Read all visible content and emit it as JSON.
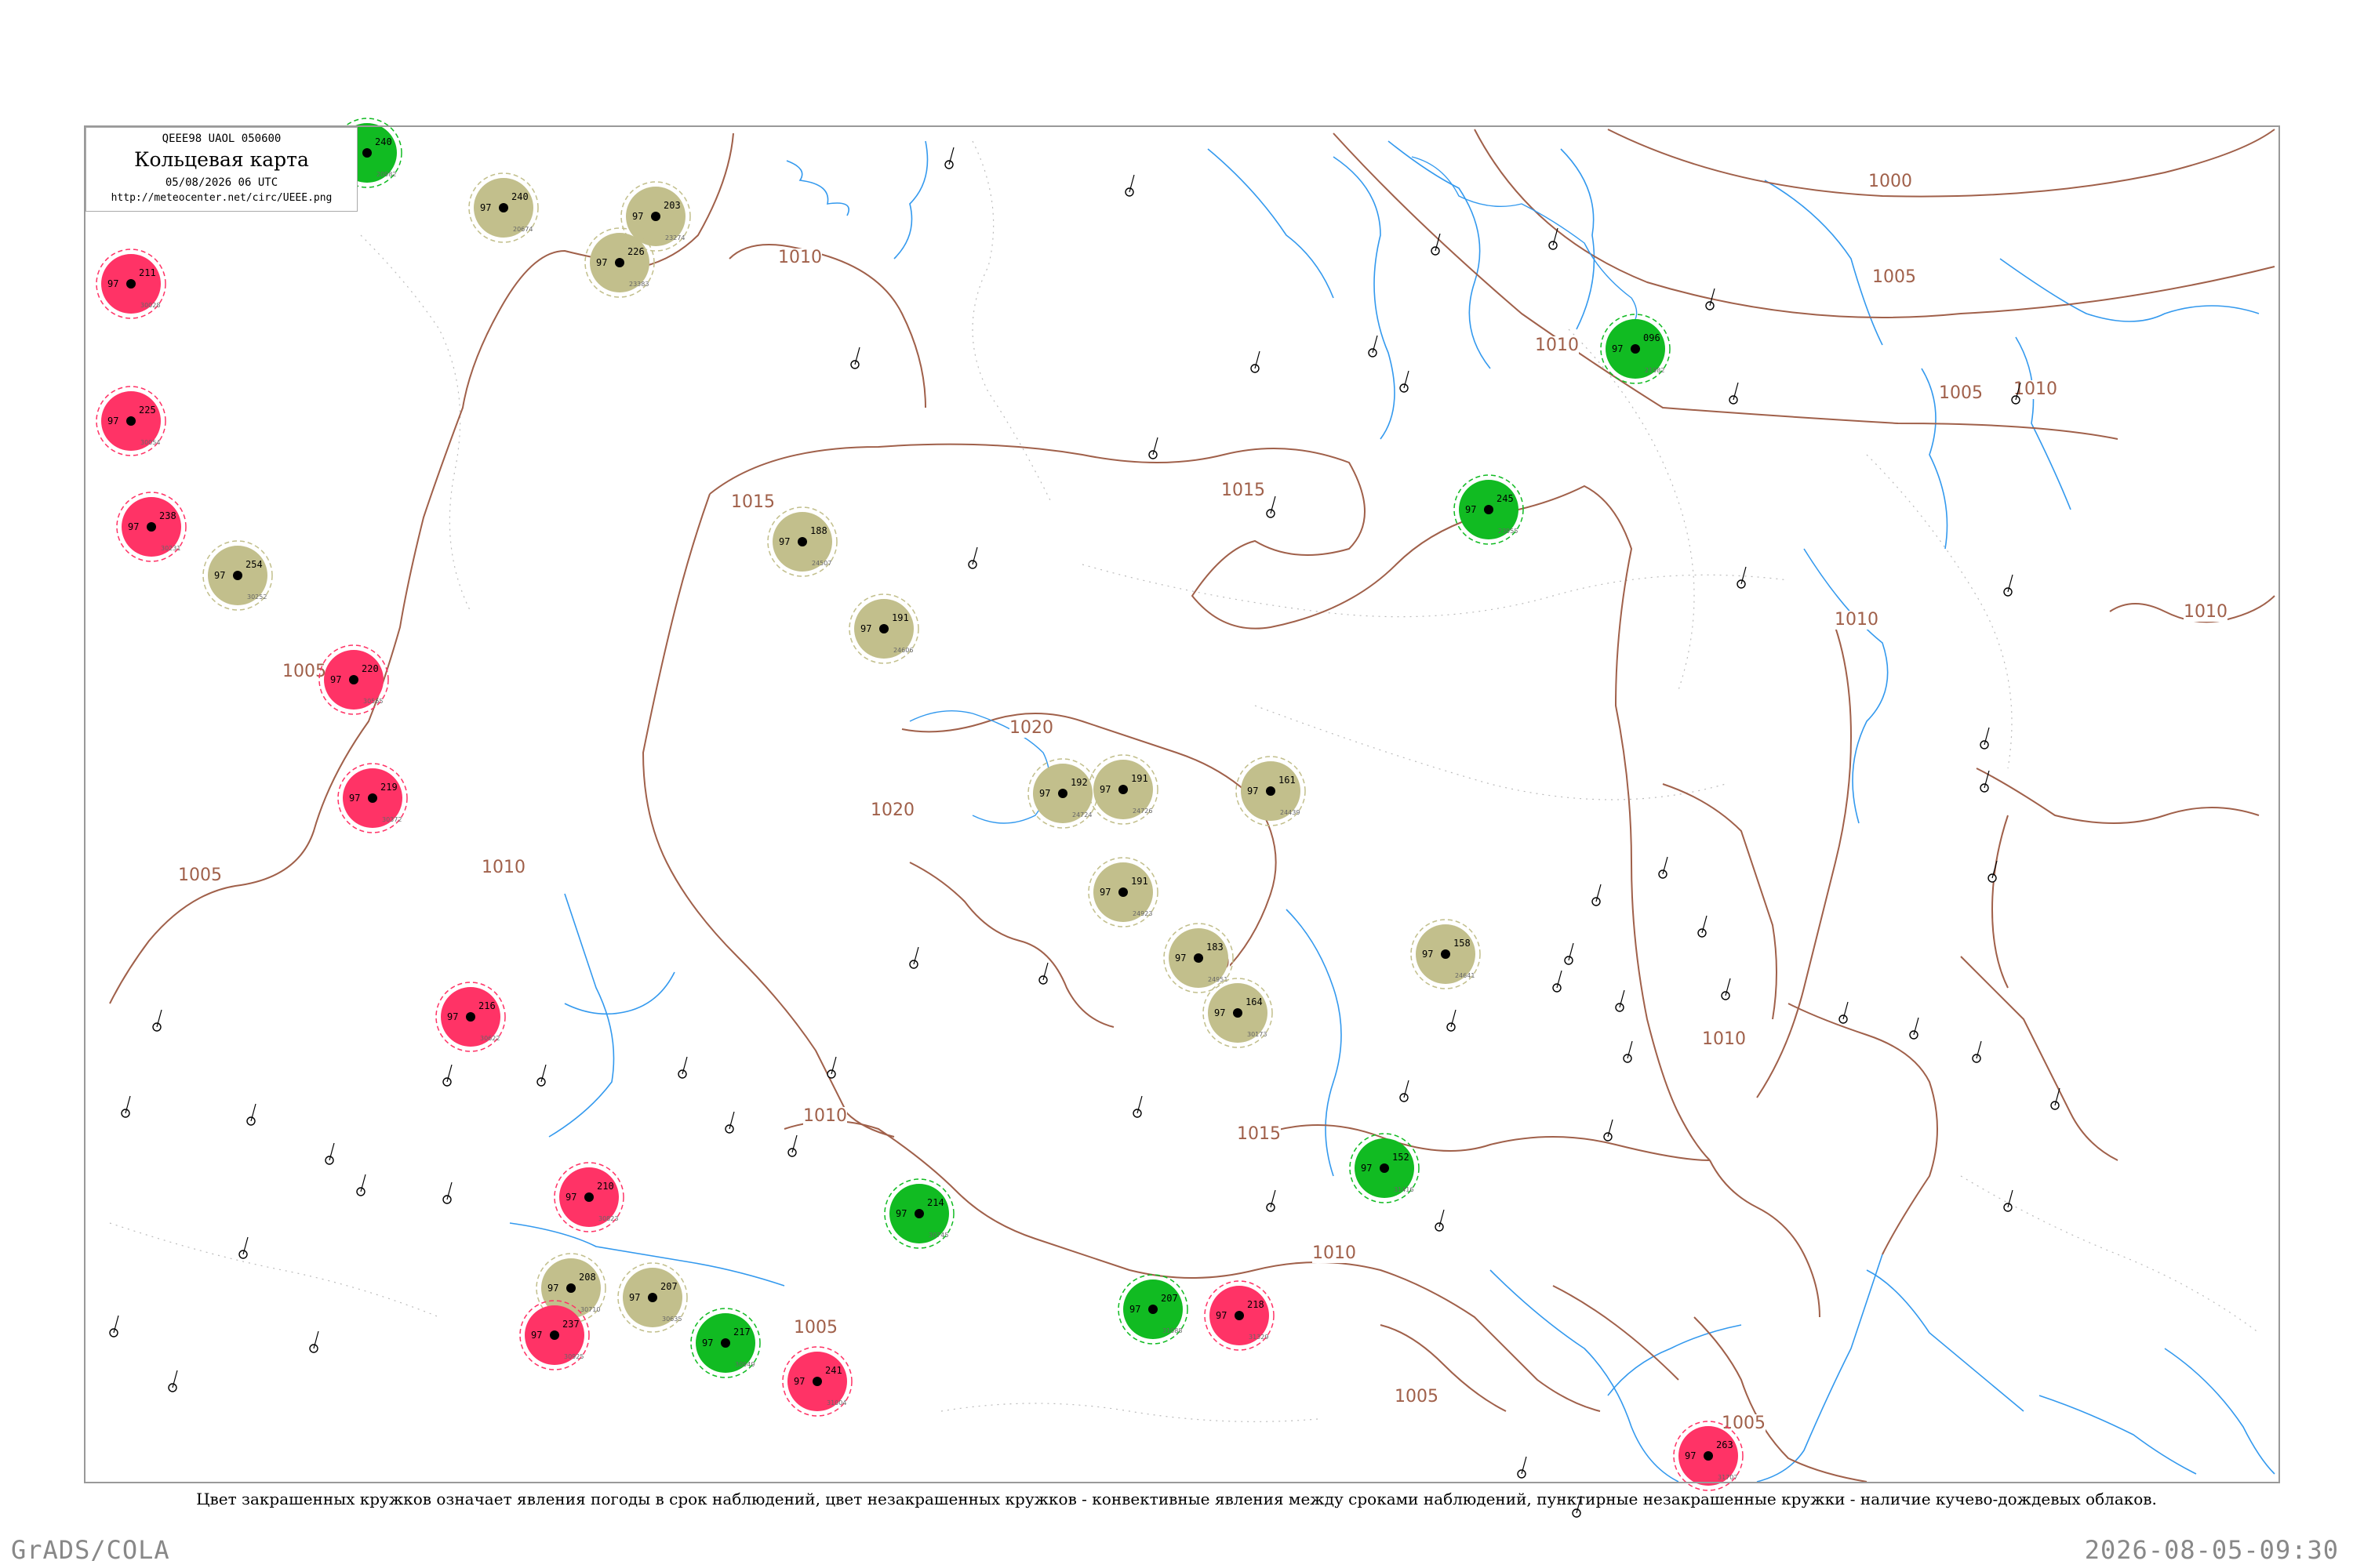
{
  "title_box": {
    "code_line": "QEEE98  UAOL  050600",
    "title": "Кольцевая карта",
    "date": "05/08/2026 06 UTC",
    "url": "http://meteocenter.net/circ/UEEE.png"
  },
  "legend_note": "Цвет закрашенных кружков означает явления погоды в срок наблюдений, цвет незакрашенных кружков - конвективные явления между сроками наблюдений, пунктирные незакрашенные кружки - наличие кучево-дождевых облаков.",
  "footer": {
    "left": "GrADS/COLA",
    "right": "2026-08-05-09:30"
  },
  "colors": {
    "isobar": "#a0604a",
    "rivers": "#3399ee",
    "thunder_fill": "#ff3366",
    "rain_fill": "#11bb22",
    "haze_fill": "#c2bf8c",
    "frame": "#999999"
  },
  "isobars": {
    "labels": [
      "1000",
      "1005",
      "1010",
      "1015",
      "1020"
    ]
  },
  "map": {
    "isobar_labels": [
      {
        "text": "1000"
      },
      {
        "text": "1005"
      },
      {
        "text": "1010"
      },
      {
        "text": "1010"
      },
      {
        "text": "1005"
      },
      {
        "text": "1010"
      },
      {
        "text": "1015"
      },
      {
        "text": "1015"
      },
      {
        "text": "1010"
      },
      {
        "text": "1010"
      },
      {
        "text": "1005"
      },
      {
        "text": "1020"
      },
      {
        "text": "1020"
      },
      {
        "text": "1020"
      },
      {
        "text": "1010"
      },
      {
        "text": "1005"
      },
      {
        "text": "1010"
      },
      {
        "text": "1015"
      },
      {
        "text": "1010"
      },
      {
        "text": "1010"
      },
      {
        "text": "1005"
      },
      {
        "text": "1005"
      },
      {
        "text": "1005"
      }
    ],
    "stations": [
      {
        "p": "240",
        "t": "97",
        "idx": "20674",
        "kind": "haze"
      },
      {
        "p": "203",
        "t": "97",
        "idx": "23274",
        "kind": "haze"
      },
      {
        "p": "226",
        "t": "97",
        "idx": "23383",
        "kind": "haze"
      },
      {
        "p": "096",
        "t": "97",
        "idx": "21982",
        "kind": "rain"
      },
      {
        "p": "245",
        "t": "97",
        "idx": "23955",
        "kind": "rain"
      },
      {
        "p": "188",
        "t": "97",
        "idx": "24507",
        "kind": "haze"
      },
      {
        "p": "191",
        "t": "97",
        "idx": "24606",
        "kind": "haze"
      },
      {
        "p": "192",
        "t": "97",
        "idx": "24724",
        "kind": "haze"
      },
      {
        "p": "191",
        "t": "97",
        "idx": "24726",
        "kind": "haze"
      },
      {
        "p": "161",
        "t": "97",
        "idx": "24439",
        "kind": "haze"
      },
      {
        "p": "191",
        "t": "97",
        "idx": "24923",
        "kind": "haze"
      },
      {
        "p": "183",
        "t": "97",
        "idx": "24951",
        "kind": "haze"
      },
      {
        "p": "164",
        "t": "97",
        "idx": "30173",
        "kind": "haze"
      },
      {
        "p": "158",
        "t": "97",
        "idx": "24641",
        "kind": "haze"
      },
      {
        "p": "240",
        "t": "97",
        "idx": "20982",
        "kind": "rain"
      },
      {
        "p": "211",
        "t": "97",
        "idx": "30028",
        "kind": "thunder"
      },
      {
        "p": "225",
        "t": "97",
        "idx": "30054",
        "kind": "thunder"
      },
      {
        "p": "238",
        "t": "97",
        "idx": "30231",
        "kind": "thunder"
      },
      {
        "p": "254",
        "t": "97",
        "idx": "30252",
        "kind": "haze"
      },
      {
        "p": "219",
        "t": "97",
        "idx": "30372",
        "kind": "thunder"
      },
      {
        "p": "220",
        "t": "97",
        "idx": "30565",
        "kind": "thunder"
      },
      {
        "p": "216",
        "t": "97",
        "idx": "30622",
        "kind": "thunder"
      },
      {
        "p": "208",
        "t": "97",
        "idx": "30710",
        "kind": "haze"
      },
      {
        "p": "207",
        "t": "97",
        "idx": "30635",
        "kind": "haze"
      },
      {
        "p": "214",
        "t": "97",
        "idx": "30745",
        "kind": "rain"
      },
      {
        "p": "210",
        "t": "97",
        "idx": "30823",
        "kind": "thunder"
      },
      {
        "p": "237",
        "t": "97",
        "idx": "30925",
        "kind": "thunder"
      },
      {
        "p": "217",
        "t": "97",
        "idx": "30949",
        "kind": "rain"
      },
      {
        "p": "241",
        "t": "97",
        "idx": "31004",
        "kind": "thunder"
      },
      {
        "p": "207",
        "t": "97",
        "idx": "31088",
        "kind": "rain"
      },
      {
        "p": "218",
        "t": "97",
        "idx": "31329",
        "kind": "thunder"
      },
      {
        "p": "152",
        "t": "97",
        "idx": "31416",
        "kind": "rain"
      },
      {
        "p": "263",
        "t": "97",
        "idx": "31707",
        "kind": "thunder"
      }
    ]
  }
}
